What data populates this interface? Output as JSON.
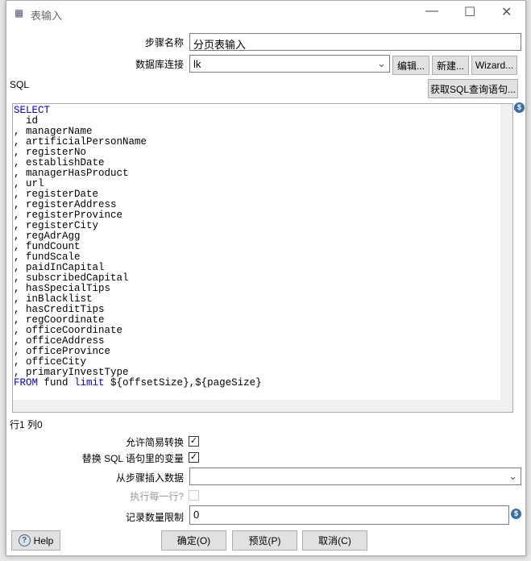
{
  "window": {
    "title": "表输入",
    "icon": "table-icon"
  },
  "form": {
    "step_name_label": "步骤名称",
    "step_name_value": "分页表输入",
    "db_conn_label": "数据库连接",
    "db_conn_value": "lk",
    "edit_btn": "编辑...",
    "new_btn": "新建...",
    "wizard_btn": "Wizard...",
    "sql_label": "SQL",
    "get_sql_btn": "获取SQL查询语句...",
    "sql_lines": [
      {
        "kw": "SELECT",
        "rest": ""
      },
      {
        "kw": "",
        "rest": "  id"
      },
      {
        "kw": "",
        "rest": ", managerName"
      },
      {
        "kw": "",
        "rest": ", artificialPersonName"
      },
      {
        "kw": "",
        "rest": ", registerNo"
      },
      {
        "kw": "",
        "rest": ", establishDate"
      },
      {
        "kw": "",
        "rest": ", managerHasProduct"
      },
      {
        "kw": "",
        "rest": ", url"
      },
      {
        "kw": "",
        "rest": ", registerDate"
      },
      {
        "kw": "",
        "rest": ", registerAddress"
      },
      {
        "kw": "",
        "rest": ", registerProvince"
      },
      {
        "kw": "",
        "rest": ", registerCity"
      },
      {
        "kw": "",
        "rest": ", regAdrAgg"
      },
      {
        "kw": "",
        "rest": ", fundCount"
      },
      {
        "kw": "",
        "rest": ", fundScale"
      },
      {
        "kw": "",
        "rest": ", paidInCapital"
      },
      {
        "kw": "",
        "rest": ", subscribedCapital"
      },
      {
        "kw": "",
        "rest": ", hasSpecialTips"
      },
      {
        "kw": "",
        "rest": ", inBlacklist"
      },
      {
        "kw": "",
        "rest": ", hasCreditTips"
      },
      {
        "kw": "",
        "rest": ", regCoordinate"
      },
      {
        "kw": "",
        "rest": ", officeCoordinate"
      },
      {
        "kw": "",
        "rest": ", officeAddress"
      },
      {
        "kw": "",
        "rest": ", officeProvince"
      },
      {
        "kw": "",
        "rest": ", officeCity"
      },
      {
        "kw": "",
        "rest": ", primaryInvestType"
      }
    ],
    "sql_last": {
      "kw1": "FROM",
      "t1": " fund ",
      "kw2": "limit",
      "t2": " ${offsetSize},${pageSize}"
    },
    "cursor_pos": "行1 列0",
    "lazy_label": "允许简易转换",
    "lazy_checked": true,
    "replace_vars_label": "替换 SQL 语句里的变量",
    "replace_vars_checked": true,
    "insert_from_label": "从步骤插入数据",
    "insert_from_value": "",
    "each_row_label": "执行每一行?",
    "each_row_checked": false,
    "limit_label": "记录数量限制",
    "limit_value": "0"
  },
  "buttons": {
    "help": "Help",
    "ok": "确定(O)",
    "preview": "预览(P)",
    "cancel": "取消(C)"
  }
}
